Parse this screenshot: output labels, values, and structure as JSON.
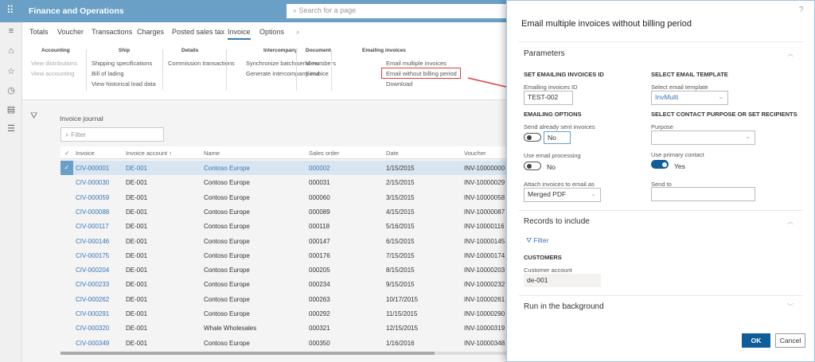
{
  "app": {
    "title": "Finance and Operations",
    "search_placeholder": "Search for a page"
  },
  "tabs": [
    "Totals",
    "Voucher",
    "Transactions",
    "Charges",
    "Posted sales tax",
    "Invoice",
    "Options"
  ],
  "ribbon": {
    "accounting": {
      "title": "Accounting",
      "items": [
        "View distributions",
        "View accounting"
      ]
    },
    "ship": {
      "title": "Ship",
      "items": [
        "Shipping specifications",
        "Bill of lading",
        "View historical load data"
      ]
    },
    "details": {
      "title": "Details",
      "items": [
        "Commission transactions"
      ]
    },
    "intercompany": {
      "title": "Intercompany",
      "items": [
        "Synchronize batch/serial numbers",
        "Generate intercompany invoice"
      ]
    },
    "document": {
      "title": "Document",
      "items": [
        "View",
        "Send"
      ]
    },
    "emailing": {
      "title": "Emailing invoices",
      "items": [
        "Email multiple invoices",
        "Email without billing period",
        "Download"
      ]
    }
  },
  "grid": {
    "title": "Invoice journal",
    "filter_placeholder": "Filter",
    "columns": [
      "Invoice",
      "Invoice account",
      "Name",
      "Sales order",
      "Date",
      "Voucher"
    ],
    "rows": [
      [
        "CIV-000001",
        "DE-001",
        "Contoso Europe",
        "000002",
        "1/15/2015",
        "INV-10000000"
      ],
      [
        "CIV-000030",
        "DE-001",
        "Contoso Europe",
        "000031",
        "2/15/2015",
        "INV-10000029"
      ],
      [
        "CIV-000059",
        "DE-001",
        "Contoso Europe",
        "000060",
        "3/15/2015",
        "INV-10000058"
      ],
      [
        "CIV-000088",
        "DE-001",
        "Contoso Europe",
        "000089",
        "4/15/2015",
        "INV-10000087"
      ],
      [
        "CIV-000117",
        "DE-001",
        "Contoso Europe",
        "000118",
        "5/16/2015",
        "INV-10000116"
      ],
      [
        "CIV-000146",
        "DE-001",
        "Contoso Europe",
        "000147",
        "6/15/2015",
        "INV-10000145"
      ],
      [
        "CIV-000175",
        "DE-001",
        "Contoso Europe",
        "000176",
        "7/15/2015",
        "INV-10000174"
      ],
      [
        "CIV-000204",
        "DE-001",
        "Contoso Europe",
        "000205",
        "8/15/2015",
        "INV-10000203"
      ],
      [
        "CIV-000233",
        "DE-001",
        "Contoso Europe",
        "000234",
        "9/15/2015",
        "INV-10000232"
      ],
      [
        "CIV-000262",
        "DE-001",
        "Contoso Europe",
        "000263",
        "10/17/2015",
        "INV-10000261"
      ],
      [
        "CIV-000291",
        "DE-001",
        "Contoso Europe",
        "000292",
        "11/15/2015",
        "INV-10000290"
      ],
      [
        "CIV-000320",
        "DE-001",
        "Whale Wholesales",
        "000321",
        "12/15/2015",
        "INV-10000319"
      ],
      [
        "CIV-000349",
        "DE-001",
        "Contoso Europe",
        "000350",
        "1/16/2016",
        "INV-10000348"
      ]
    ]
  },
  "dialog": {
    "help": "?",
    "title": "Email multiple invoices without billing period",
    "parameters": "Parameters",
    "set_id_section": "SET EMAILING INVOICES ID",
    "id_label": "Emailing invoices ID",
    "id_value": "TEST-002",
    "options_section": "EMAILING OPTIONS",
    "send_sent_label": "Send already sent invoices",
    "send_sent_value": "No",
    "use_processing_label": "Use email processing",
    "use_processing_value": "No",
    "attach_label": "Attach invoices to email as",
    "attach_value": "Merged PDF",
    "template_section": "SELECT EMAIL TEMPLATE",
    "template_label": "Select email template",
    "template_value": "InvMulti",
    "contact_section": "SELECT CONTACT PURPOSE OR SET RECIPIENTS",
    "purpose_label": "Purpose",
    "purpose_value": "",
    "primary_label": "Use primary contact",
    "primary_value": "Yes",
    "send_to_label": "Send to",
    "send_to_value": "",
    "records": "Records to include",
    "filter": "Filter",
    "customers": "CUSTOMERS",
    "cust_label": "Customer account",
    "cust_value": "de-001",
    "background": "Run in the background",
    "ok": "OK",
    "cancel": "Cancel"
  }
}
